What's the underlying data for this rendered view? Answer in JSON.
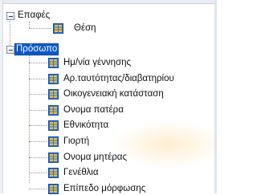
{
  "tree": {
    "groups": [
      {
        "label": "Επαφές",
        "expanded": true,
        "selected": false,
        "children": [
          "Θέση"
        ]
      },
      {
        "label": "Πρόσωπο",
        "expanded": true,
        "selected": true,
        "children": [
          "Ημ/νία γέννησης",
          "Αρ.ταυτότητας/διαβατηρίου",
          "Οικογενειακή κατάσταση",
          "Ονομα πατέρα",
          "Εθνικότητα",
          "Γιορτή",
          "Ονομα μητέρας",
          "Γενέθλια",
          "Επίπεδο μόρφωσης"
        ]
      }
    ],
    "icon": "field-table-icon"
  },
  "colors": {
    "selection": "#0a57c8",
    "icon_blue": "#2f6fd1",
    "icon_yellow": "#f2c230"
  }
}
